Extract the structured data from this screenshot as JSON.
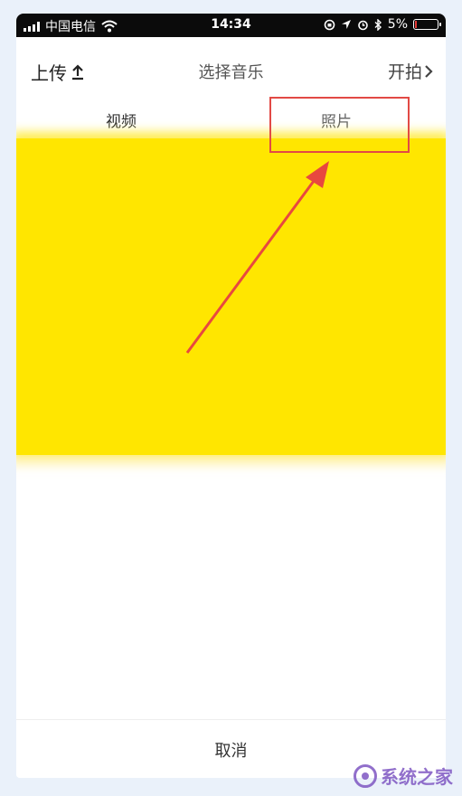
{
  "status_bar": {
    "carrier": "中国电信",
    "time": "14:34",
    "battery": "5%",
    "battery_level": 0.05
  },
  "header": {
    "upload_label": "上传",
    "title": "选择音乐",
    "shoot_label": "开拍"
  },
  "tabs": {
    "video": "视频",
    "photo": "照片"
  },
  "footer": {
    "cancel": "取消"
  },
  "watermark": {
    "text": "系统之家"
  },
  "colors": {
    "highlight": "#e24a45",
    "content": "#ffe600",
    "watermark": "#7e57c2"
  }
}
